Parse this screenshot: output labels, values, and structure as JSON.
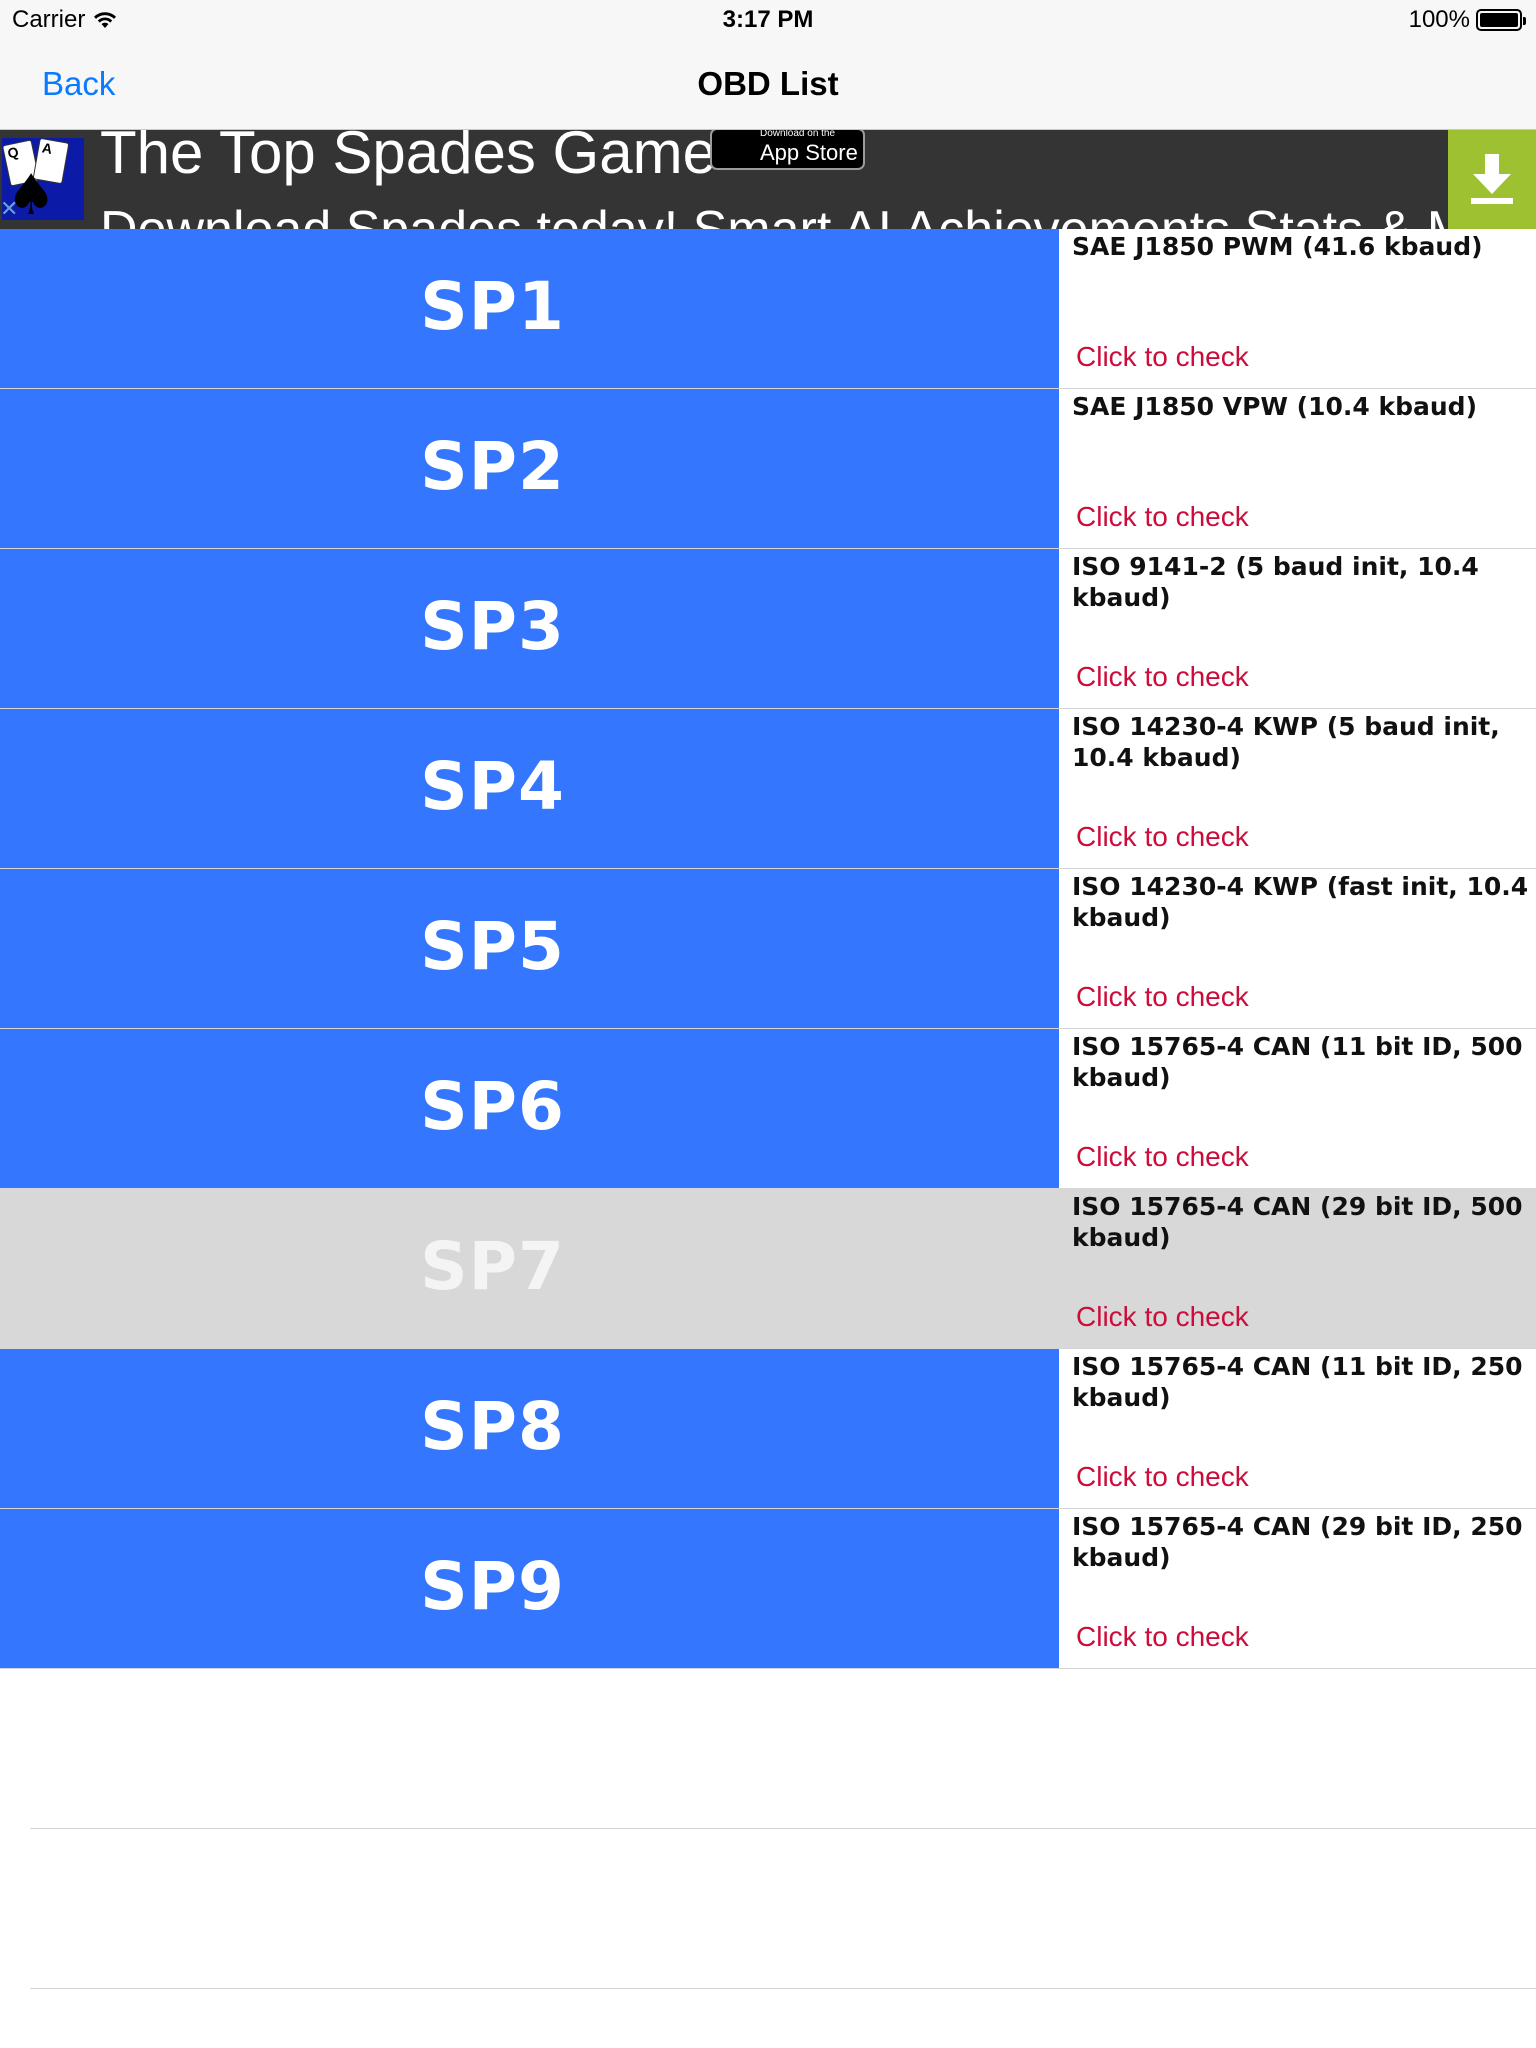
{
  "status_bar": {
    "carrier": "Carrier",
    "time": "3:17 PM",
    "battery": "100%"
  },
  "nav": {
    "back_label": "Back",
    "title": "OBD List",
    "accent_color": "#0a7aff"
  },
  "ad": {
    "title": "The Top Spades Game",
    "subtitle": "Download Spades today! Smart AI Achievements Stats & More",
    "appstore_small": "Download on the",
    "appstore_big": "App Store",
    "card_left": "Q",
    "card_right": "A",
    "close_icon": "close-icon",
    "download_icon": "download-icon"
  },
  "list": {
    "check_label": "Click to check",
    "row_color": "#3476fd",
    "disabled_color": "#d8d8d8",
    "check_color": "#cc0d3a",
    "rows": [
      {
        "code": "SP1",
        "desc": "SAE J1850 PWM (41.6 kbaud)",
        "check": "Click to check",
        "enabled": true
      },
      {
        "code": "SP2",
        "desc": "SAE J1850 VPW (10.4 kbaud)",
        "check": "Click to check",
        "enabled": true
      },
      {
        "code": "SP3",
        "desc": "ISO 9141-2 (5 baud init, 10.4 kbaud)",
        "check": "Click to check",
        "enabled": true
      },
      {
        "code": "SP4",
        "desc": "ISO 14230-4 KWP (5 baud init, 10.4 kbaud)",
        "check": "Click to check",
        "enabled": true
      },
      {
        "code": "SP5",
        "desc": "ISO 14230-4 KWP (fast init, 10.4 kbaud)",
        "check": "Click to check",
        "enabled": true
      },
      {
        "code": "SP6",
        "desc": "ISO 15765-4 CAN (11 bit ID, 500 kbaud)",
        "check": "Click to check",
        "enabled": true
      },
      {
        "code": "SP7",
        "desc": "ISO 15765-4 CAN (29 bit ID, 500 kbaud)",
        "check": "Click to check",
        "enabled": false
      },
      {
        "code": "SP8",
        "desc": "ISO 15765-4 CAN (11 bit ID, 250 kbaud)",
        "check": "Click to check",
        "enabled": true
      },
      {
        "code": "SP9",
        "desc": "ISO 15765-4 CAN (29 bit ID, 250 kbaud)",
        "check": "Click to check",
        "enabled": true
      }
    ]
  }
}
